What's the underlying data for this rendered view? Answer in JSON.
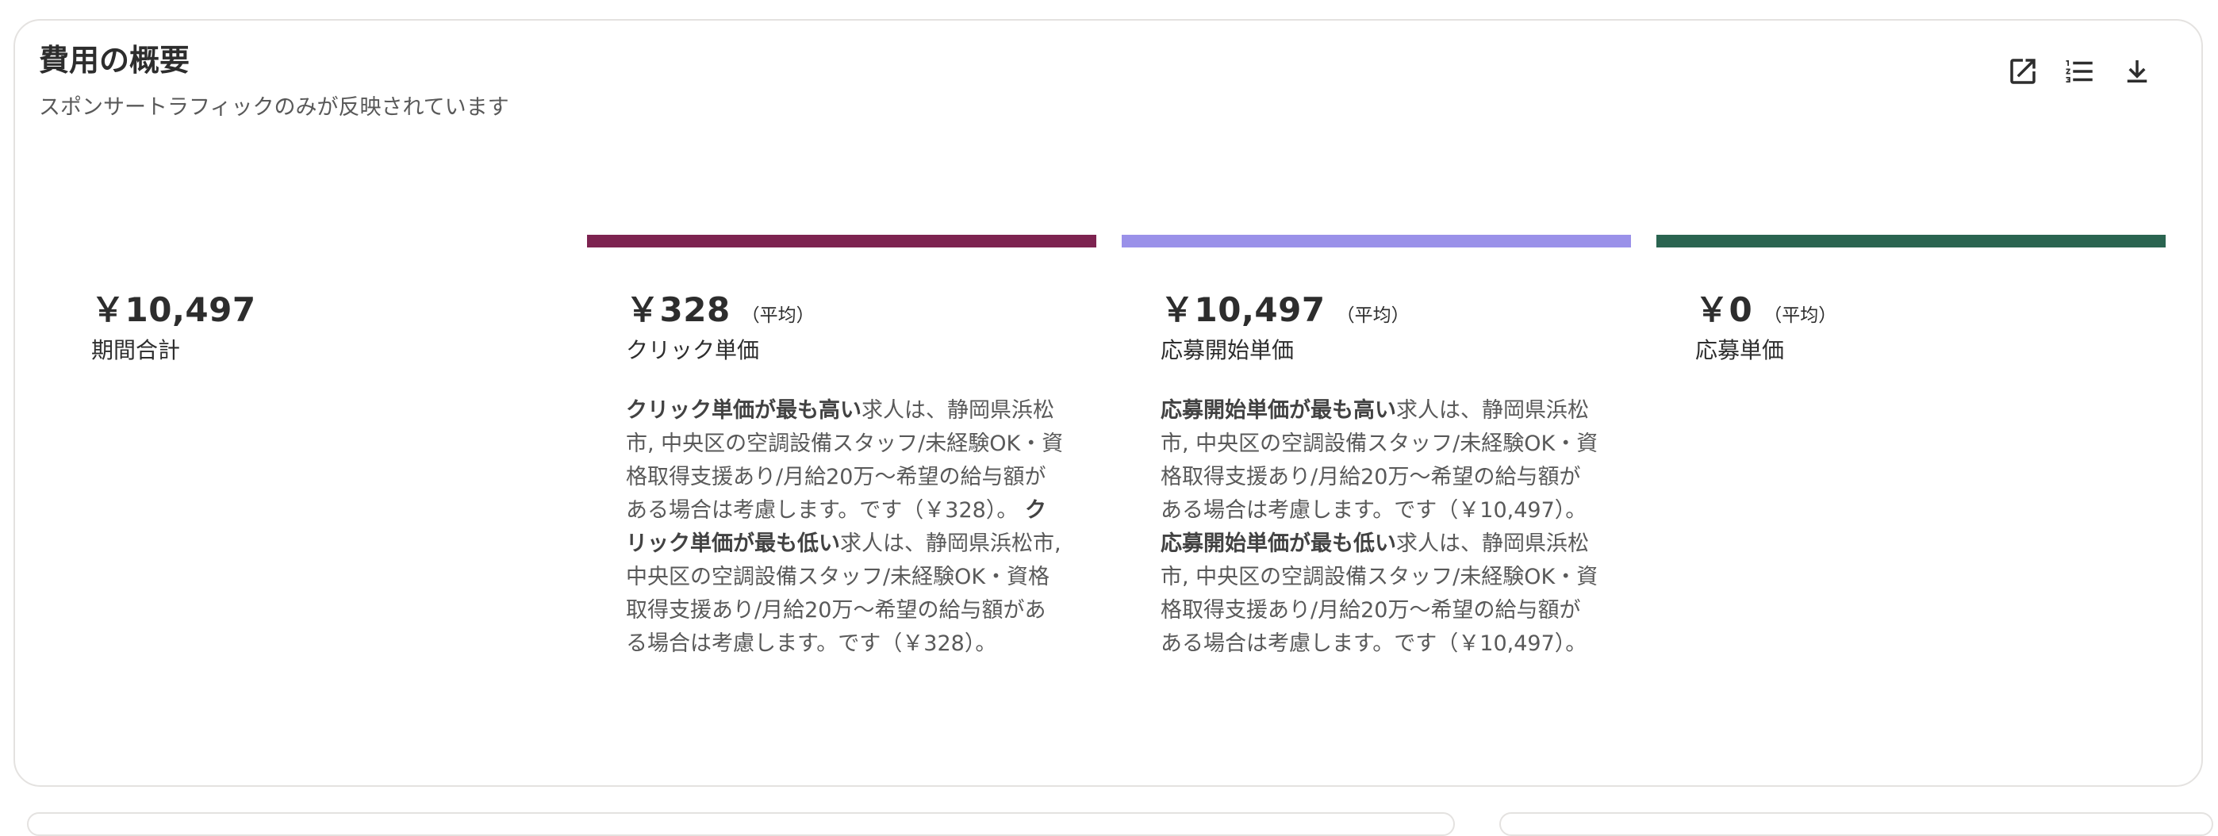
{
  "header": {
    "title": "費用の概要",
    "subtitle": "スポンサートラフィックのみが反映されています"
  },
  "toolbar": {
    "open_icon": "open-in-new-icon",
    "list_icon": "numbered-list-icon",
    "download_icon": "download-icon"
  },
  "metrics": [
    {
      "value": "￥10,497",
      "avg_label": "",
      "label": "期間合計",
      "color": ""
    },
    {
      "value": "￥328",
      "avg_label": "（平均）",
      "label": "クリック単価",
      "color": "#7d2350",
      "desc": {
        "high_label": "クリック単価が最も高い",
        "high_text": "求人は、静岡県浜松市, 中央区の空調設備スタッフ/未経験OK・資格取得支援あり/月給20万〜希望の給与額がある場合は考慮します。です（￥328）。",
        "low_label": "クリック単価が最も低い",
        "low_text": "求人は、静岡県浜松市, 中央区の空調設備スタッフ/未経験OK・資格取得支援あり/月給20万〜希望の給与額がある場合は考慮します。です（￥328）。"
      }
    },
    {
      "value": "￥10,497",
      "avg_label": "（平均）",
      "label": "応募開始単価",
      "color": "#9a91e9",
      "desc": {
        "high_label": "応募開始単価が最も高い",
        "high_text": "求人は、静岡県浜松市, 中央区の空調設備スタッフ/未経験OK・資格取得支援あり/月給20万〜希望の給与額がある場合は考慮します。です（￥10,497）。",
        "low_label": "応募開始単価が最も低い",
        "low_text": "求人は、静岡県浜松市, 中央区の空調設備スタッフ/未経験OK・資格取得支援あり/月給20万〜希望の給与額がある場合は考慮します。です（￥10,497）。"
      }
    },
    {
      "value": "￥0",
      "avg_label": "（平均）",
      "label": "応募単価",
      "color": "#2a6450"
    }
  ]
}
